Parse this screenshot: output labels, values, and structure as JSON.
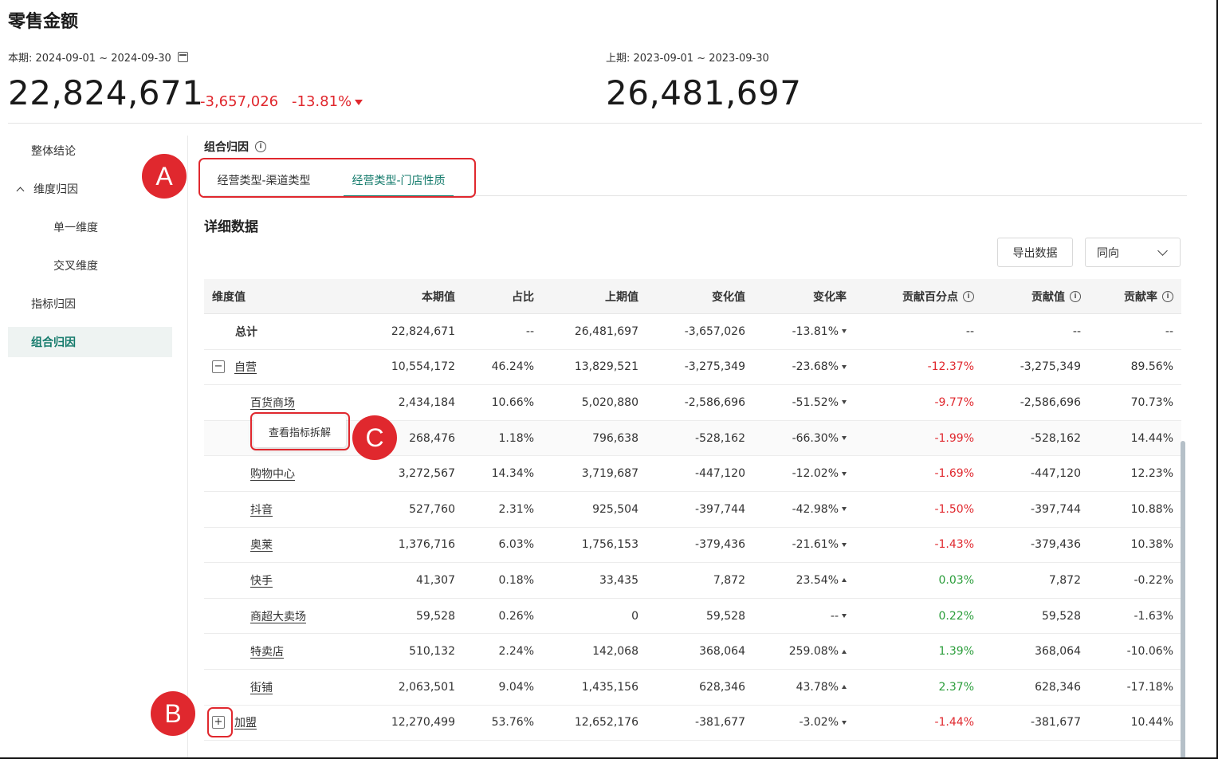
{
  "page": {
    "title": "零售金额"
  },
  "kpi": {
    "current_period": "本期: 2024-09-01 ~ 2024-09-30",
    "current_value": "22,824,671",
    "diff_abs": "-3,657,026",
    "diff_rate": "-13.81%",
    "previous_period": "上期: 2023-09-01 ~ 2023-09-30",
    "previous_value": "26,481,697"
  },
  "sidebar": {
    "items": [
      {
        "label": "整体结论"
      },
      {
        "label": "维度归因"
      },
      {
        "label": "单一维度"
      },
      {
        "label": "交叉维度"
      },
      {
        "label": "指标归因"
      },
      {
        "label": "组合归因"
      }
    ]
  },
  "section": {
    "title": "组合归因",
    "info_glyph": "i",
    "tabs": [
      {
        "label": "经营类型-渠道类型"
      },
      {
        "label": "经营类型-门店性质"
      }
    ],
    "detail_title": "详细数据"
  },
  "toolbar": {
    "export_label": "导出数据",
    "select_value": "同向"
  },
  "table": {
    "headers": [
      "维度值",
      "本期值",
      "占比",
      "上期值",
      "变化值",
      "变化率",
      "贡献百分点",
      "贡献值",
      "贡献率"
    ],
    "rows": [
      {
        "dim": "总计",
        "cur": "22,824,671",
        "share": "--",
        "prev": "26,481,697",
        "change": "-3,657,026",
        "rate": "-13.81%",
        "pp": "--",
        "contrib": "--",
        "crate": "--"
      },
      {
        "dim": "自营",
        "cur": "10,554,172",
        "share": "46.24%",
        "prev": "13,829,521",
        "change": "-3,275,349",
        "rate": "-23.68%",
        "pp": "-12.37%",
        "contrib": "-3,275,349",
        "crate": "89.56%"
      },
      {
        "dim": "百货商场",
        "cur": "2,434,184",
        "share": "10.66%",
        "prev": "5,020,880",
        "change": "-2,586,696",
        "rate": "-51.52%",
        "pp": "-9.77%",
        "contrib": "-2,586,696",
        "crate": "70.73%"
      },
      {
        "dim": "",
        "cur": "268,476",
        "share": "1.18%",
        "prev": "796,638",
        "change": "-528,162",
        "rate": "-66.30%",
        "pp": "-1.99%",
        "contrib": "-528,162",
        "crate": "14.44%"
      },
      {
        "dim": "购物中心",
        "cur": "3,272,567",
        "share": "14.34%",
        "prev": "3,719,687",
        "change": "-447,120",
        "rate": "-12.02%",
        "pp": "-1.69%",
        "contrib": "-447,120",
        "crate": "12.23%"
      },
      {
        "dim": "抖音",
        "cur": "527,760",
        "share": "2.31%",
        "prev": "925,504",
        "change": "-397,744",
        "rate": "-42.98%",
        "pp": "-1.50%",
        "contrib": "-397,744",
        "crate": "10.88%"
      },
      {
        "dim": "奥莱",
        "cur": "1,376,716",
        "share": "6.03%",
        "prev": "1,756,153",
        "change": "-379,436",
        "rate": "-21.61%",
        "pp": "-1.43%",
        "contrib": "-379,436",
        "crate": "10.38%"
      },
      {
        "dim": "快手",
        "cur": "41,307",
        "share": "0.18%",
        "prev": "33,435",
        "change": "7,872",
        "rate": "23.54%",
        "pp": "0.03%",
        "contrib": "7,872",
        "crate": "-0.22%"
      },
      {
        "dim": "商超大卖场",
        "cur": "59,528",
        "share": "0.26%",
        "prev": "0",
        "change": "59,528",
        "rate": "--",
        "pp": "0.22%",
        "contrib": "59,528",
        "crate": "-1.63%"
      },
      {
        "dim": "特卖店",
        "cur": "510,132",
        "share": "2.24%",
        "prev": "142,068",
        "change": "368,064",
        "rate": "259.08%",
        "pp": "1.39%",
        "contrib": "368,064",
        "crate": "-10.06%"
      },
      {
        "dim": "街铺",
        "cur": "2,063,501",
        "share": "9.04%",
        "prev": "1,435,156",
        "change": "628,346",
        "rate": "43.78%",
        "pp": "2.37%",
        "contrib": "628,346",
        "crate": "-17.18%"
      },
      {
        "dim": "加盟",
        "cur": "12,270,499",
        "share": "53.76%",
        "prev": "12,652,176",
        "change": "-381,677",
        "rate": "-3.02%",
        "pp": "-1.44%",
        "contrib": "-381,677",
        "crate": "10.44%"
      }
    ],
    "expander_collapse": "−",
    "expander_expand": "+"
  },
  "tooltip": {
    "label": "查看指标拆解"
  },
  "annotations": {
    "a": "A",
    "b": "B",
    "c": "C"
  },
  "colors": {
    "accent": "#137a6b",
    "negative": "#e0282e",
    "positive": "#2a9d3a",
    "annotation": "#e0282e"
  }
}
